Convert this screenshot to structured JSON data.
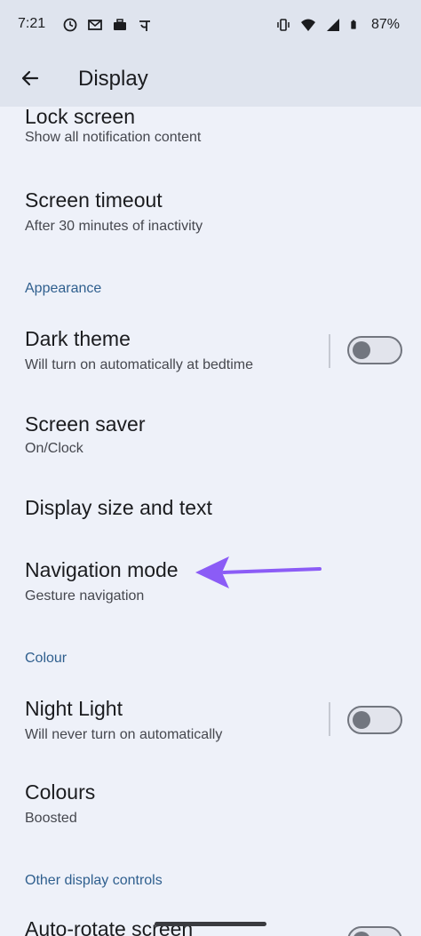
{
  "status_bar": {
    "time": "7:21",
    "left_icons": [
      "data-saver-icon",
      "mail-icon",
      "briefcase-icon",
      "app-notification-icon"
    ],
    "right_icons": [
      "vibrate-icon",
      "wifi-icon",
      "signal-icon",
      "battery-icon"
    ],
    "battery_percent": "87%"
  },
  "app_bar": {
    "title": "Display",
    "back_icon": "arrow-back-icon"
  },
  "items": {
    "lock_screen": {
      "title": "Lock screen",
      "subtitle": "Show all notification content"
    },
    "screen_timeout": {
      "title": "Screen timeout",
      "subtitle": "After 30 minutes of inactivity"
    },
    "appearance_header": "Appearance",
    "dark_theme": {
      "title": "Dark theme",
      "subtitle": "Will turn on automatically at bedtime",
      "enabled": false
    },
    "screen_saver": {
      "title": "Screen saver",
      "subtitle": "On/Clock"
    },
    "display_size": {
      "title": "Display size and text"
    },
    "navigation_mode": {
      "title": "Navigation mode",
      "subtitle": "Gesture navigation"
    },
    "colour_header": "Colour",
    "night_light": {
      "title": "Night Light",
      "subtitle": "Will never turn on automatically",
      "enabled": false
    },
    "colours": {
      "title": "Colours",
      "subtitle": "Boosted"
    },
    "other_header": "Other display controls",
    "auto_rotate": {
      "title": "Auto-rotate screen"
    }
  },
  "annotation": {
    "arrow_color": "#8b5cf6"
  },
  "colors": {
    "background": "#eef1f9",
    "app_bar": "#dfe4ee",
    "section_header": "#2f5f8e",
    "switch_off": "#72767f"
  }
}
